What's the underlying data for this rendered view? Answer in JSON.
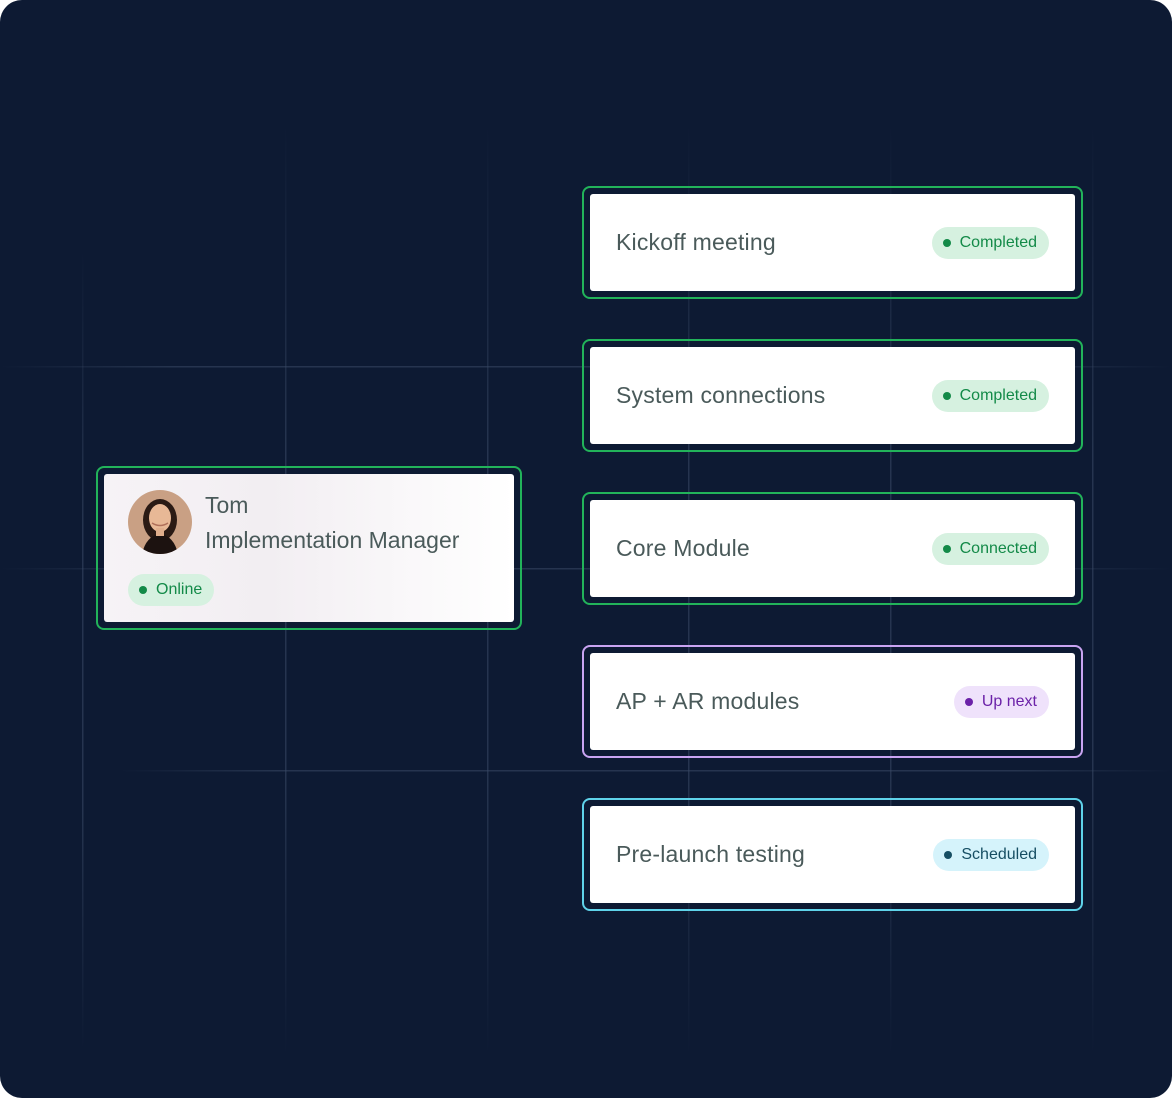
{
  "profile": {
    "name": "Tom",
    "role": "Implementation Manager",
    "status": "Online",
    "avatar_icon": "person-avatar-photo"
  },
  "tasks": [
    {
      "title": "Kickoff meeting",
      "status": "Completed",
      "tone": "green"
    },
    {
      "title": "System connections",
      "status": "Completed",
      "tone": "green"
    },
    {
      "title": "Core Module",
      "status": "Connected",
      "tone": "green"
    },
    {
      "title": "AP + AR modules",
      "status": "Up next",
      "tone": "purple"
    },
    {
      "title": "Pre-launch testing",
      "status": "Scheduled",
      "tone": "cyan"
    }
  ],
  "colors": {
    "background": "#0d1a33",
    "green_border": "#22b35a",
    "purple_border": "#c9a4f2",
    "cyan_border": "#5fd3ea",
    "green_text": "#138a48",
    "purple_text": "#6b21a8",
    "cyan_text": "#164e63"
  }
}
